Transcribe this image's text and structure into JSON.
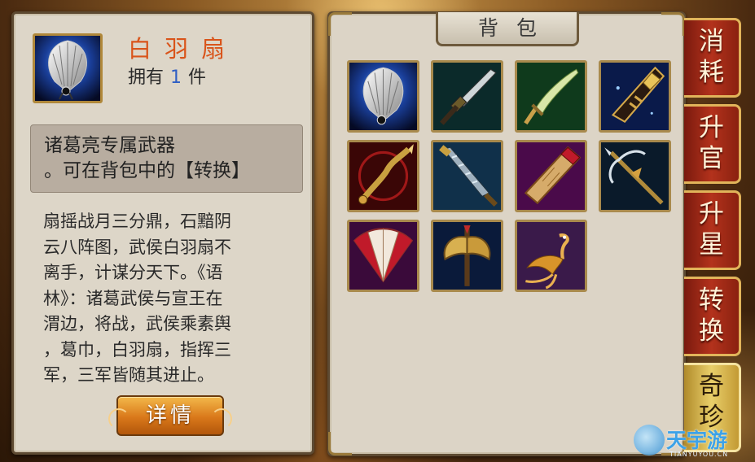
{
  "item": {
    "name": "白羽扇",
    "own_prefix": "拥有",
    "own_count": "1",
    "own_suffix": "件",
    "summary_line1": "诸葛亮专属武器",
    "summary_line2": "。可在背包中的【转换】",
    "description_lines": [
      "扇摇战月三分鼎，石黯阴",
      "云八阵图，武侯白羽扇不",
      "离手，计谋分天下。《语",
      "林》：诸葛武侯与宣王在",
      "渭边，将战，武侯乘素舆",
      "，葛巾，白羽扇，指挥三",
      "军，三军皆随其进止。"
    ],
    "details_button": "详情"
  },
  "bag": {
    "title": "背包",
    "slots": [
      {
        "icon": "white-feather-fan-icon"
      },
      {
        "icon": "black-blade-sword-icon"
      },
      {
        "icon": "green-jade-broadsword-icon"
      },
      {
        "icon": "golden-command-token-blade-icon"
      },
      {
        "icon": "flaming-serpent-spear-icon"
      },
      {
        "icon": "steel-serrated-blade-icon"
      },
      {
        "icon": "red-scroll-bamboo-slip-icon"
      },
      {
        "icon": "golden-halberd-spear-icon"
      },
      {
        "icon": "red-folding-fan-icon"
      },
      {
        "icon": "golden-battle-axe-icon"
      },
      {
        "icon": "golden-phoenix-icon"
      }
    ]
  },
  "tabs": [
    {
      "label": "消耗",
      "active": false
    },
    {
      "label": "升官",
      "active": false
    },
    {
      "label": "升星",
      "active": false
    },
    {
      "label": "转换",
      "active": false
    },
    {
      "label": "奇珍",
      "active": true
    }
  ],
  "watermark": {
    "text": "天宇游",
    "url": "TIANYUYOU.CN"
  },
  "colors": {
    "item_name": "#d9541a",
    "own_count": "#2f5fc4",
    "tab_red": "#b3321c",
    "tab_active_gold": "#e9cf6a"
  }
}
